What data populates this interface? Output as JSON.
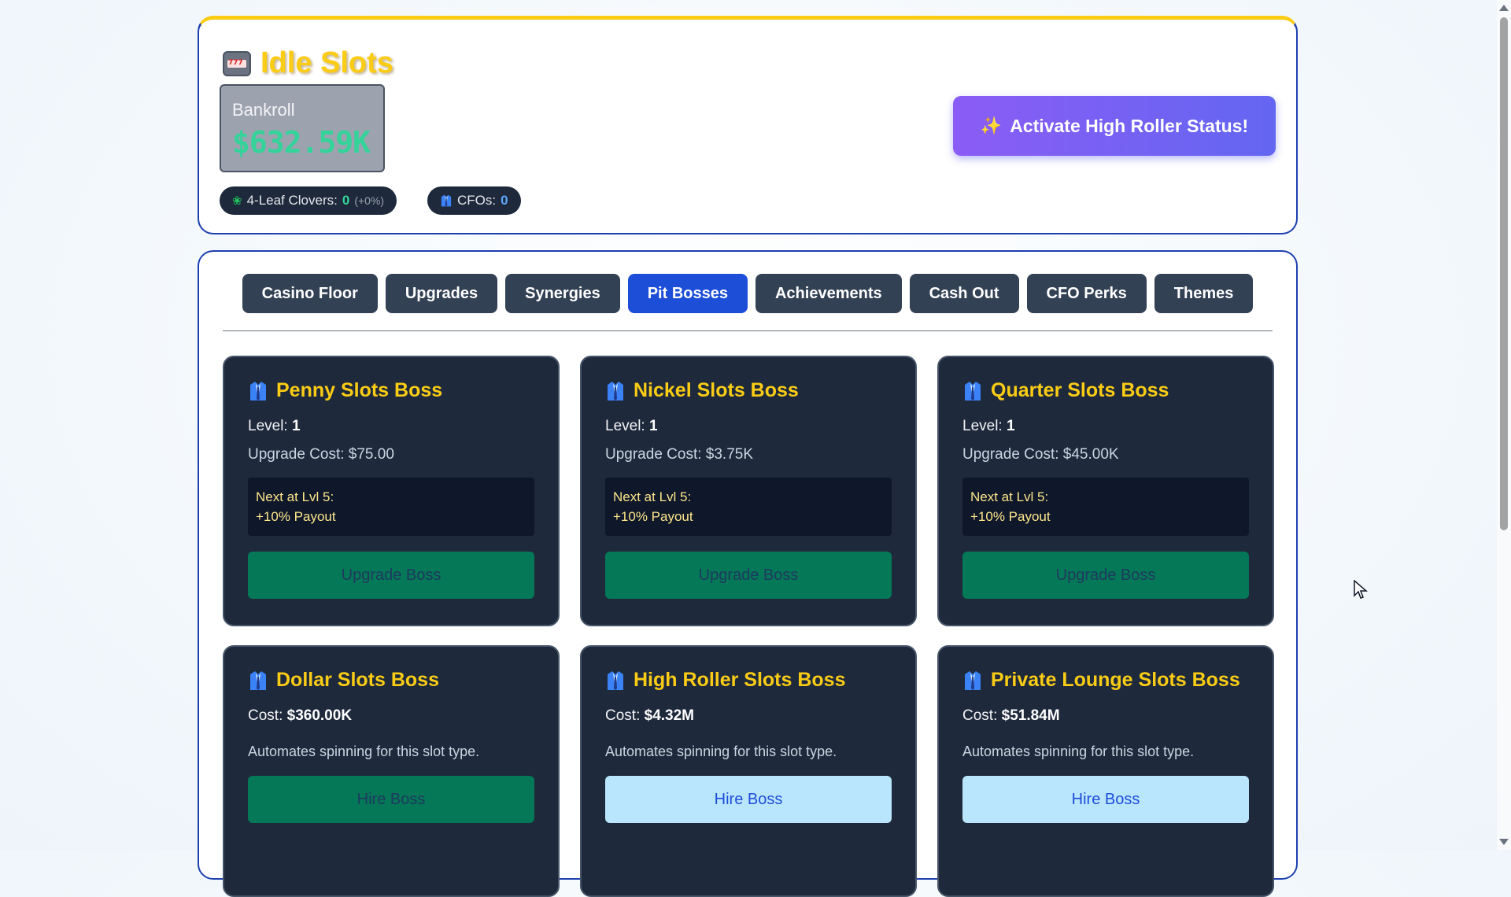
{
  "header": {
    "title": "Idle Slots",
    "bankroll_label": "Bankroll",
    "bankroll_value": "$632.59K",
    "clovers_label": "4-Leaf Clovers:",
    "clovers_value": "0",
    "clovers_bonus": "(+0%)",
    "cfos_label": "CFOs:",
    "cfos_value": "0",
    "high_roller_button": "Activate High Roller Status!"
  },
  "tabs": [
    {
      "label": "Casino Floor",
      "active": false
    },
    {
      "label": "Upgrades",
      "active": false
    },
    {
      "label": "Synergies",
      "active": false
    },
    {
      "label": "Pit Bosses",
      "active": true
    },
    {
      "label": "Achievements",
      "active": false
    },
    {
      "label": "Cash Out",
      "active": false
    },
    {
      "label": "CFO Perks",
      "active": false
    },
    {
      "label": "Themes",
      "active": false
    }
  ],
  "hired_bosses": [
    {
      "name": "Penny Slots Boss",
      "level_label": "Level:",
      "level": "1",
      "upgrade_cost": "Upgrade Cost: $75.00",
      "next_line1": "Next at Lvl 5:",
      "next_line2": "+10% Payout",
      "button": "Upgrade Boss"
    },
    {
      "name": "Nickel Slots Boss",
      "level_label": "Level:",
      "level": "1",
      "upgrade_cost": "Upgrade Cost: $3.75K",
      "next_line1": "Next at Lvl 5:",
      "next_line2": "+10% Payout",
      "button": "Upgrade Boss"
    },
    {
      "name": "Quarter Slots Boss",
      "level_label": "Level:",
      "level": "1",
      "upgrade_cost": "Upgrade Cost: $45.00K",
      "next_line1": "Next at Lvl 5:",
      "next_line2": "+10% Payout",
      "button": "Upgrade Boss"
    }
  ],
  "available_bosses": [
    {
      "name": "Dollar Slots Boss",
      "cost_label": "Cost:",
      "cost": "$360.00K",
      "description": "Automates spinning for this slot type.",
      "button": "Hire Boss",
      "affordable": true
    },
    {
      "name": "High Roller Slots Boss",
      "cost_label": "Cost:",
      "cost": "$4.32M",
      "description": "Automates spinning for this slot type.",
      "button": "Hire Boss",
      "affordable": false
    },
    {
      "name": "Private Lounge Slots Boss",
      "cost_label": "Cost:",
      "cost": "$51.84M",
      "description": "Automates spinning for this slot type.",
      "button": "Hire Boss",
      "affordable": false
    }
  ],
  "colors": {
    "title_gold": "#facc15",
    "bankroll_green": "#34d399",
    "active_tab": "#1d4ed8",
    "card_bg": "#1e293b",
    "affordable_button": "#047857",
    "unaffordable_button": "#bae6fd"
  },
  "icons": {
    "logo": "slot-machine-icon",
    "clover": "four-leaf-clover-icon",
    "boss": "suit-icon",
    "button_sparkle": "sparkles-icon"
  }
}
